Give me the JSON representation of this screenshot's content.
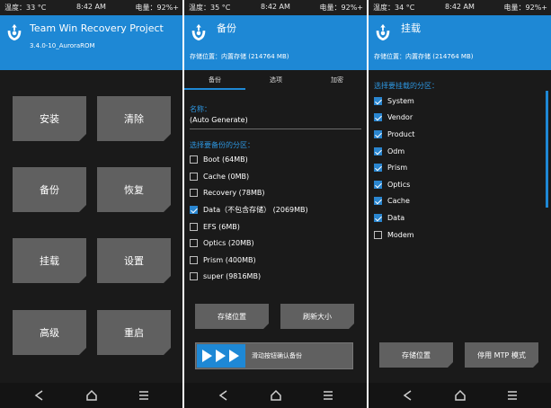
{
  "status_bar": [
    {
      "temp": "温度：33 °C",
      "time": "8:42 AM",
      "battery": "电量：92%+"
    },
    {
      "temp": "温度：35 °C",
      "time": "8:42 AM",
      "battery": "电量：92%+"
    },
    {
      "temp": "温度：34 °C",
      "time": "8:42 AM",
      "battery": "电量：92%+"
    }
  ],
  "screen1": {
    "title": "Team Win Recovery Project",
    "subtitle": "3.4.0-10_AuroraROM",
    "buttons": [
      "安装",
      "清除",
      "备份",
      "恢复",
      "挂载",
      "设置",
      "高级",
      "重启"
    ]
  },
  "screen2": {
    "title": "备份",
    "subtitle": "存储位置：内置存储 (214764 MB)",
    "tabs": [
      "备份",
      "选项",
      "加密"
    ],
    "name_label": "名称：",
    "name_value": "(Auto Generate)",
    "partitions_label": "选择要备份的分区：",
    "partitions": [
      {
        "label": "Boot (64MB)",
        "checked": false
      },
      {
        "label": "Cache (0MB)",
        "checked": false
      },
      {
        "label": "Recovery (78MB)",
        "checked": false
      },
      {
        "label": "Data（不包含存储） (2069MB)",
        "checked": true
      },
      {
        "label": "EFS (6MB)",
        "checked": false
      },
      {
        "label": "Optics (20MB)",
        "checked": false
      },
      {
        "label": "Prism (400MB)",
        "checked": false
      },
      {
        "label": "super (9816MB)",
        "checked": false
      }
    ],
    "storage_button": "存储位置",
    "refresh_button": "刷新大小",
    "slider_text": "滑动按钮确认备份"
  },
  "screen3": {
    "title": "挂载",
    "subtitle": "存储位置：内置存储 (214764 MB)",
    "partitions_label": "选择要挂载的分区：",
    "partitions": [
      {
        "label": "System",
        "checked": true
      },
      {
        "label": "Vendor",
        "checked": true
      },
      {
        "label": "Product",
        "checked": true
      },
      {
        "label": "Odm",
        "checked": true
      },
      {
        "label": "Prism",
        "checked": true
      },
      {
        "label": "Optics",
        "checked": true
      },
      {
        "label": "Cache",
        "checked": true
      },
      {
        "label": "Data",
        "checked": true
      },
      {
        "label": "Modem",
        "checked": false
      }
    ],
    "storage_button": "存储位置",
    "mtp_button": "停用 MTP 模式"
  },
  "colors": {
    "accent": "#1e88d5",
    "background": "#1a1a1a",
    "button": "#606060"
  },
  "icons": [
    "twrp-logo-icon",
    "back-icon",
    "home-icon",
    "menu-icon",
    "checkbox-checked-icon",
    "play-arrows-icon"
  ]
}
